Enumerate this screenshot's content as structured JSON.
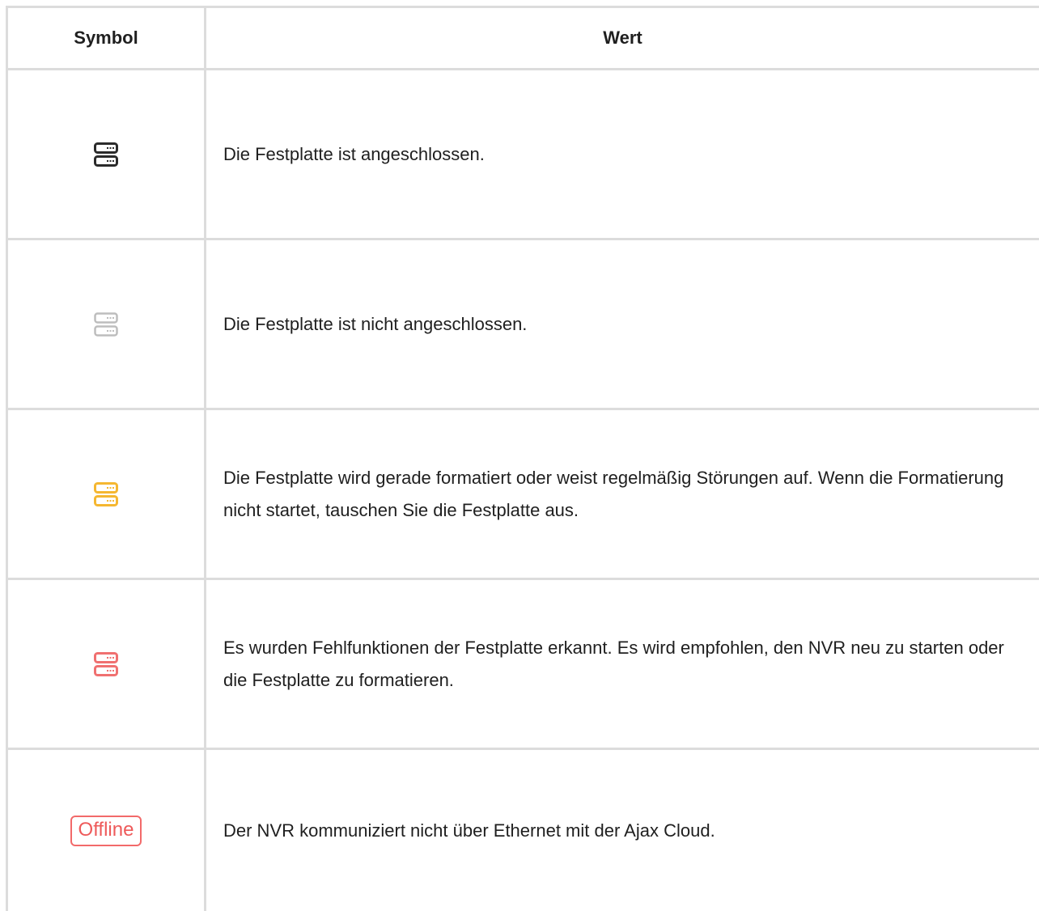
{
  "header": {
    "col_symbol": "Symbol",
    "col_value": "Wert"
  },
  "rows": [
    {
      "icon": "hdd-connected-icon",
      "icon_color": "#2b2b2b",
      "text": "Die Festplatte ist angeschlossen."
    },
    {
      "icon": "hdd-disconnected-icon",
      "icon_color": "#bdbdbd",
      "text": "Die Festplatte ist nicht angeschlossen."
    },
    {
      "icon": "hdd-formatting-icon",
      "icon_color": "#f5b731",
      "text": "Die Festplatte wird gerade formatiert oder weist regelmäßig Störungen auf. Wenn die Formatierung nicht startet, tauschen Sie die Festplatte aus."
    },
    {
      "icon": "hdd-malfunction-icon",
      "icon_color": "#f07070",
      "text": "Es wurden Fehlfunktionen der Festplatte erkannt. Es wird empfohlen, den NVR neu zu starten oder die Festplatte zu formatieren."
    },
    {
      "icon": "offline-badge",
      "icon_color": "#ee5a5a",
      "badge_label": "Offline",
      "text": "Der NVR kommuniziert nicht über Ethernet mit der Ajax Cloud."
    }
  ]
}
